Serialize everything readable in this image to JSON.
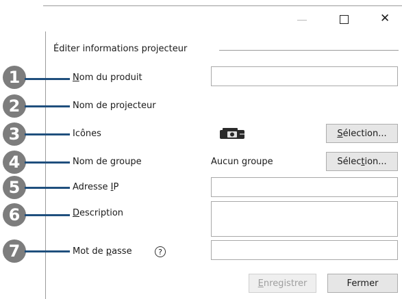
{
  "window": {
    "minimize_icon": "minimize-icon",
    "maximize_icon": "maximize-icon",
    "close_icon": "close-icon",
    "close_glyph": "✕"
  },
  "section": {
    "title": "Éditer informations projecteur"
  },
  "callouts": [
    "1",
    "2",
    "3",
    "4",
    "5",
    "6",
    "7"
  ],
  "fields": {
    "product_name": {
      "label_pre": "",
      "label_ul": "N",
      "label_post": "om du produit",
      "value": ""
    },
    "projector_name": {
      "label": "Nom de projecteur"
    },
    "icons": {
      "label": "Icônes",
      "icon": "projector-icon",
      "button_pre": "",
      "button_ul": "S",
      "button_post": "élection..."
    },
    "group_name": {
      "label": "Nom de groupe",
      "value": "Aucun groupe",
      "button_pre": "Sélec",
      "button_ul": "t",
      "button_post": "ion..."
    },
    "ip_address": {
      "label_pre": "Adresse ",
      "label_ul": "I",
      "label_post": "P",
      "value": ""
    },
    "description": {
      "label_pre": "",
      "label_ul": "D",
      "label_post": "escription",
      "value": ""
    },
    "password": {
      "label_pre": "Mot de ",
      "label_ul": "p",
      "label_post": "asse",
      "help": "?",
      "value": ""
    }
  },
  "footer": {
    "save_pre": "",
    "save_ul": "E",
    "save_post": "nregistrer",
    "close_label": "Fermer"
  },
  "colors": {
    "callout_badge": "#7d7d7d",
    "pointer_line": "#1f4f7d",
    "button_bg": "#e6e6e6"
  }
}
